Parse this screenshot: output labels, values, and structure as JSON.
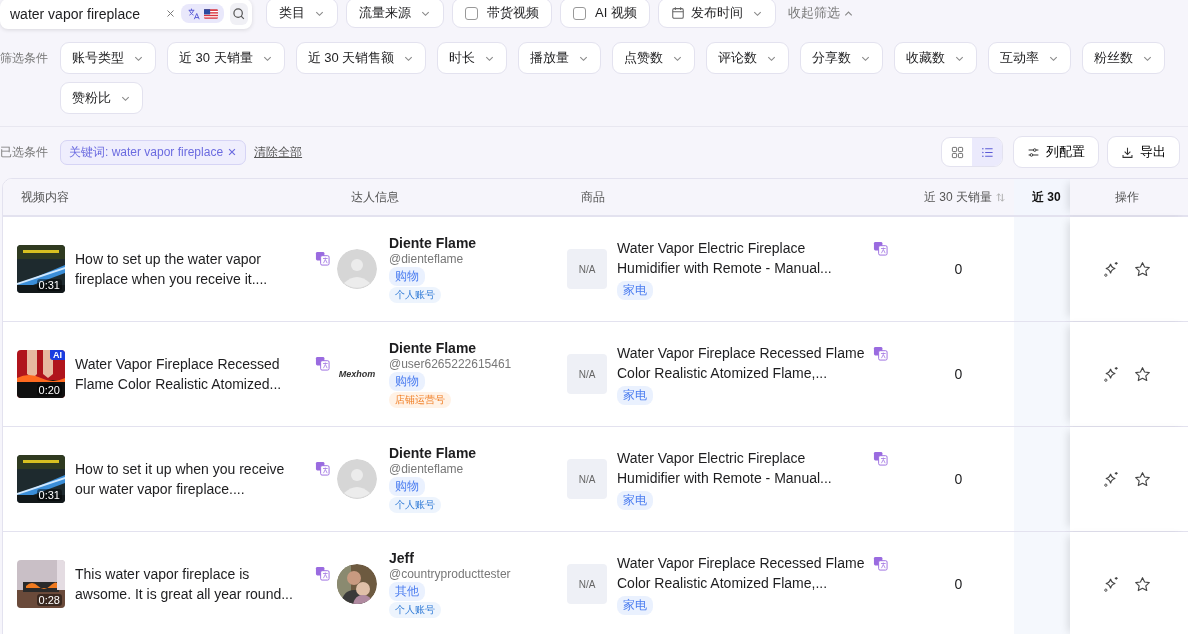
{
  "search": {
    "value": "water vapor fireplace",
    "translate_on": true
  },
  "top_filters": [
    {
      "kind": "dropdown",
      "label": "类目"
    },
    {
      "kind": "dropdown",
      "label": "流量来源"
    },
    {
      "kind": "checkbox",
      "label": "带货视频",
      "checked": false
    },
    {
      "kind": "checkbox",
      "label": "AI 视频",
      "checked": false
    },
    {
      "kind": "date",
      "label": "发布时间"
    }
  ],
  "collapse_label": "收起筛选",
  "filter_label": "筛选条件",
  "filters": [
    "账号类型",
    "近 30 天销量",
    "近 30 天销售额",
    "时长",
    "播放量",
    "点赞数",
    "评论数",
    "分享数",
    "收藏数",
    "互动率",
    "粉丝数",
    "赞粉比"
  ],
  "selected_label": "已选条件",
  "selected_chips": [
    "关键词: water vapor fireplace"
  ],
  "clear_all": "清除全部",
  "view_toggle": [
    {
      "kind": "grid",
      "selected": false
    },
    {
      "kind": "list",
      "selected": true
    }
  ],
  "buttons": [
    {
      "kind": "columns",
      "label": "列配置"
    },
    {
      "kind": "export",
      "label": "导出"
    }
  ],
  "columns": [
    {
      "label": "视频内容",
      "kind": "plain"
    },
    {
      "label": "达人信息",
      "kind": "plain"
    },
    {
      "label": "商品",
      "kind": "plain"
    },
    {
      "label": "近 30 天销量",
      "kind": "sortable"
    },
    {
      "label": "近 30",
      "kind": "pinned"
    },
    {
      "label": "操作",
      "kind": "plain"
    }
  ],
  "rows": [
    {
      "video": {
        "title_lines": [
          "How to set up the water vapor",
          "fireplace when you receive it...."
        ],
        "duration": "0:31"
      },
      "creator": {
        "kind": "placeholder",
        "name": "Diente Flame",
        "handle": "@dienteflame",
        "tags": [
          {
            "label": "购物",
            "kind": "content"
          },
          {
            "label": "个人账号",
            "kind": "personal"
          }
        ]
      },
      "product": {
        "image": "N/A",
        "title_lines": [
          "Water Vapor Electric Fireplace",
          "Humidifier with Remote - Manual..."
        ],
        "category": "家电"
      },
      "sales": "0"
    },
    {
      "video": {
        "title_lines": [
          "Water Vapor Fireplace Recessed",
          "Flame Color Realistic Atomized..."
        ],
        "duration": "0:20",
        "ai_label": "AI"
      },
      "creator": {
        "kind": "logo",
        "logo_text": "Mexhom",
        "name": "Diente Flame",
        "handle": "@user6265222615461",
        "tags": [
          {
            "label": "购物",
            "kind": "content"
          },
          {
            "label": "店铺运营号",
            "kind": "shop"
          }
        ]
      },
      "product": {
        "image": "N/A",
        "title_lines": [
          "Water Vapor Fireplace Recessed Flame",
          "Color Realistic Atomized Flame,..."
        ],
        "category": "家电"
      },
      "sales": "0"
    },
    {
      "video": {
        "title_lines": [
          "How to set it up when you receive",
          "our water vapor fireplace...."
        ],
        "duration": "0:31"
      },
      "creator": {
        "kind": "placeholder",
        "name": "Diente Flame",
        "handle": "@dienteflame",
        "tags": [
          {
            "label": "购物",
            "kind": "content"
          },
          {
            "label": "个人账号",
            "kind": "personal"
          }
        ]
      },
      "product": {
        "image": "N/A",
        "title_lines": [
          "Water Vapor Electric Fireplace",
          "Humidifier with Remote - Manual..."
        ],
        "category": "家电"
      },
      "sales": "0"
    },
    {
      "video": {
        "title_lines": [
          "This water vapor fireplace is",
          "awsome. It is great all year round..."
        ],
        "duration": "0:28"
      },
      "creator": {
        "name": "Jeff",
        "handle": "@countryproducttester",
        "tags": [
          {
            "label": "其他",
            "kind": "content"
          },
          {
            "label": "个人账号",
            "kind": "personal"
          }
        ]
      },
      "product": {
        "image": "N/A",
        "title_lines": [
          "Water Vapor Fireplace Recessed Flame",
          "Color Realistic Atomized Flame,..."
        ],
        "category": "家电"
      },
      "sales": "0"
    }
  ]
}
